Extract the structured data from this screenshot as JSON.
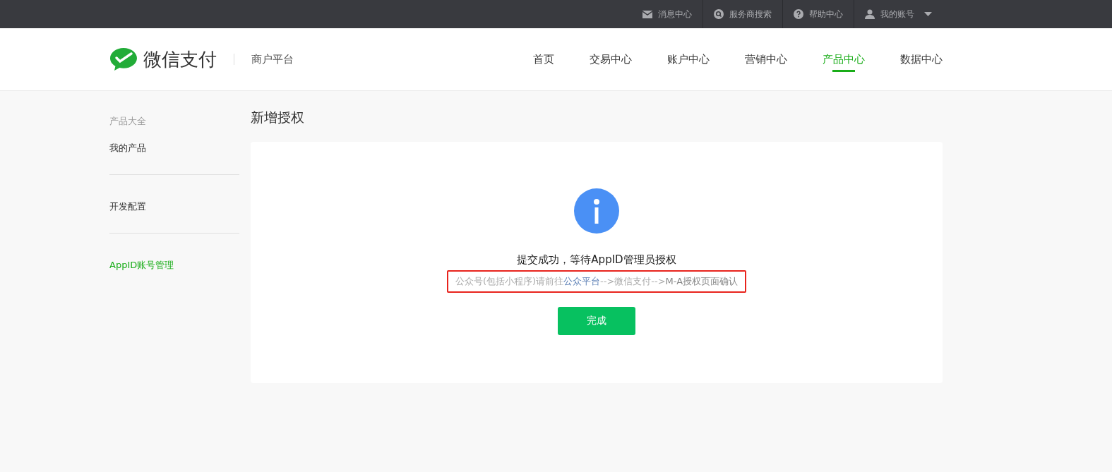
{
  "top_bar": {
    "items": [
      {
        "label": "消息中心",
        "kind": "mail"
      },
      {
        "label": "服务商搜索",
        "kind": "search"
      },
      {
        "label": "帮助中心",
        "kind": "help"
      },
      {
        "label": "我的账号",
        "kind": "account"
      }
    ]
  },
  "header": {
    "logo_text": "微信支付",
    "platform": "商户平台",
    "nav": [
      {
        "label": "首页",
        "selected": false
      },
      {
        "label": "交易中心",
        "selected": false
      },
      {
        "label": "账户中心",
        "selected": false
      },
      {
        "label": "营销中心",
        "selected": false
      },
      {
        "label": "产品中心",
        "selected": true
      },
      {
        "label": "数据中心",
        "selected": false
      }
    ]
  },
  "sidebar": {
    "groups": [
      {
        "items": [
          {
            "label": "产品大全",
            "kind": "heading",
            "selected": false
          },
          {
            "label": "我的产品",
            "kind": "link",
            "selected": false
          }
        ]
      },
      {
        "items": [
          {
            "label": "开发配置",
            "kind": "link",
            "selected": false
          }
        ]
      },
      {
        "items": [
          {
            "label": "AppID账号管理",
            "kind": "link",
            "selected": true
          }
        ]
      }
    ]
  },
  "page_title": "新增授权",
  "result": {
    "message": "提交成功，等待AppID管理员授权",
    "hint": {
      "highlighted": true,
      "segments": [
        {
          "text": "公众号(包括小程序)请前往",
          "kind": "muted"
        },
        {
          "text": "公众平台",
          "kind": "link"
        },
        {
          "text": "-->微信支付-->",
          "kind": "muted"
        },
        {
          "text": "M-A授权页面确认",
          "kind": "strong"
        }
      ]
    },
    "button": "完成"
  }
}
